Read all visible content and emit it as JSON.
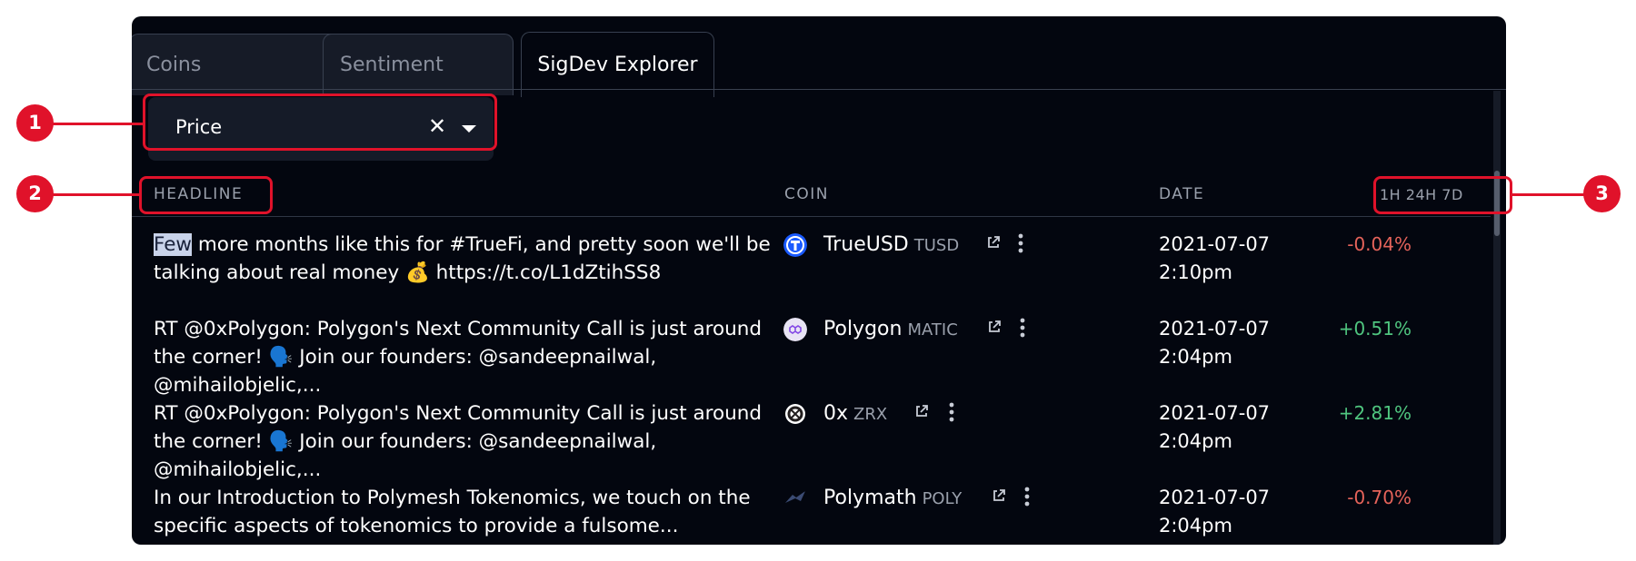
{
  "tabs": [
    {
      "label": "Coins",
      "active": false
    },
    {
      "label": "Sentiment",
      "active": false
    },
    {
      "label": "SigDev Explorer",
      "active": true
    }
  ],
  "filter": {
    "value": "Price",
    "clear_glyph": "✕",
    "chevron": "chevron-down-icon"
  },
  "table": {
    "headers": {
      "headline": "HEADLINE",
      "coin": "COIN",
      "date": "DATE",
      "change": "1H 24H 7D"
    },
    "rows": [
      {
        "headline_highlight": "Few",
        "headline_rest": " more months like this for #TrueFi, and pretty soon we'll be talking about real money 💰  https://t.co/L1dZtihSS8",
        "coin_name": "TrueUSD",
        "coin_symbol": "TUSD",
        "coin_icon": "trueusd-icon",
        "date_line1": "2021-07-07",
        "date_line2": "2:10pm",
        "change": "-0.04%"
      },
      {
        "headline_highlight": "",
        "headline_rest": "RT @0xPolygon: Polygon's Next Community Call is just around the corner! 🗣️ Join our founders: @sandeepnailwal, @mihailobjelic,...",
        "coin_name": "Polygon",
        "coin_symbol": "MATIC",
        "coin_icon": "polygon-icon",
        "date_line1": "2021-07-07",
        "date_line2": "2:04pm",
        "change": "+0.51%"
      },
      {
        "headline_highlight": "",
        "headline_rest": "RT @0xPolygon: Polygon's Next Community Call is just around the corner! 🗣️ Join our founders: @sandeepnailwal, @mihailobjelic,...",
        "coin_name": "0x",
        "coin_symbol": "ZRX",
        "coin_icon": "zrx-icon",
        "date_line1": "2021-07-07",
        "date_line2": "2:04pm",
        "change": "+2.81%"
      },
      {
        "headline_highlight": "",
        "headline_rest": "In our Introduction to Polymesh Tokenomics, we touch on the specific aspects of tokenomics to provide a fulsome...",
        "coin_name": "Polymath",
        "coin_symbol": "POLY",
        "coin_icon": "polymath-icon",
        "date_line1": "2021-07-07",
        "date_line2": "2:04pm",
        "change": "-0.70%"
      }
    ]
  },
  "callouts": [
    "1",
    "2",
    "3"
  ],
  "colors": {
    "callout": "#e0122a",
    "negative": "#e5635a",
    "positive": "#4fc57f",
    "panel": "#03060f"
  }
}
